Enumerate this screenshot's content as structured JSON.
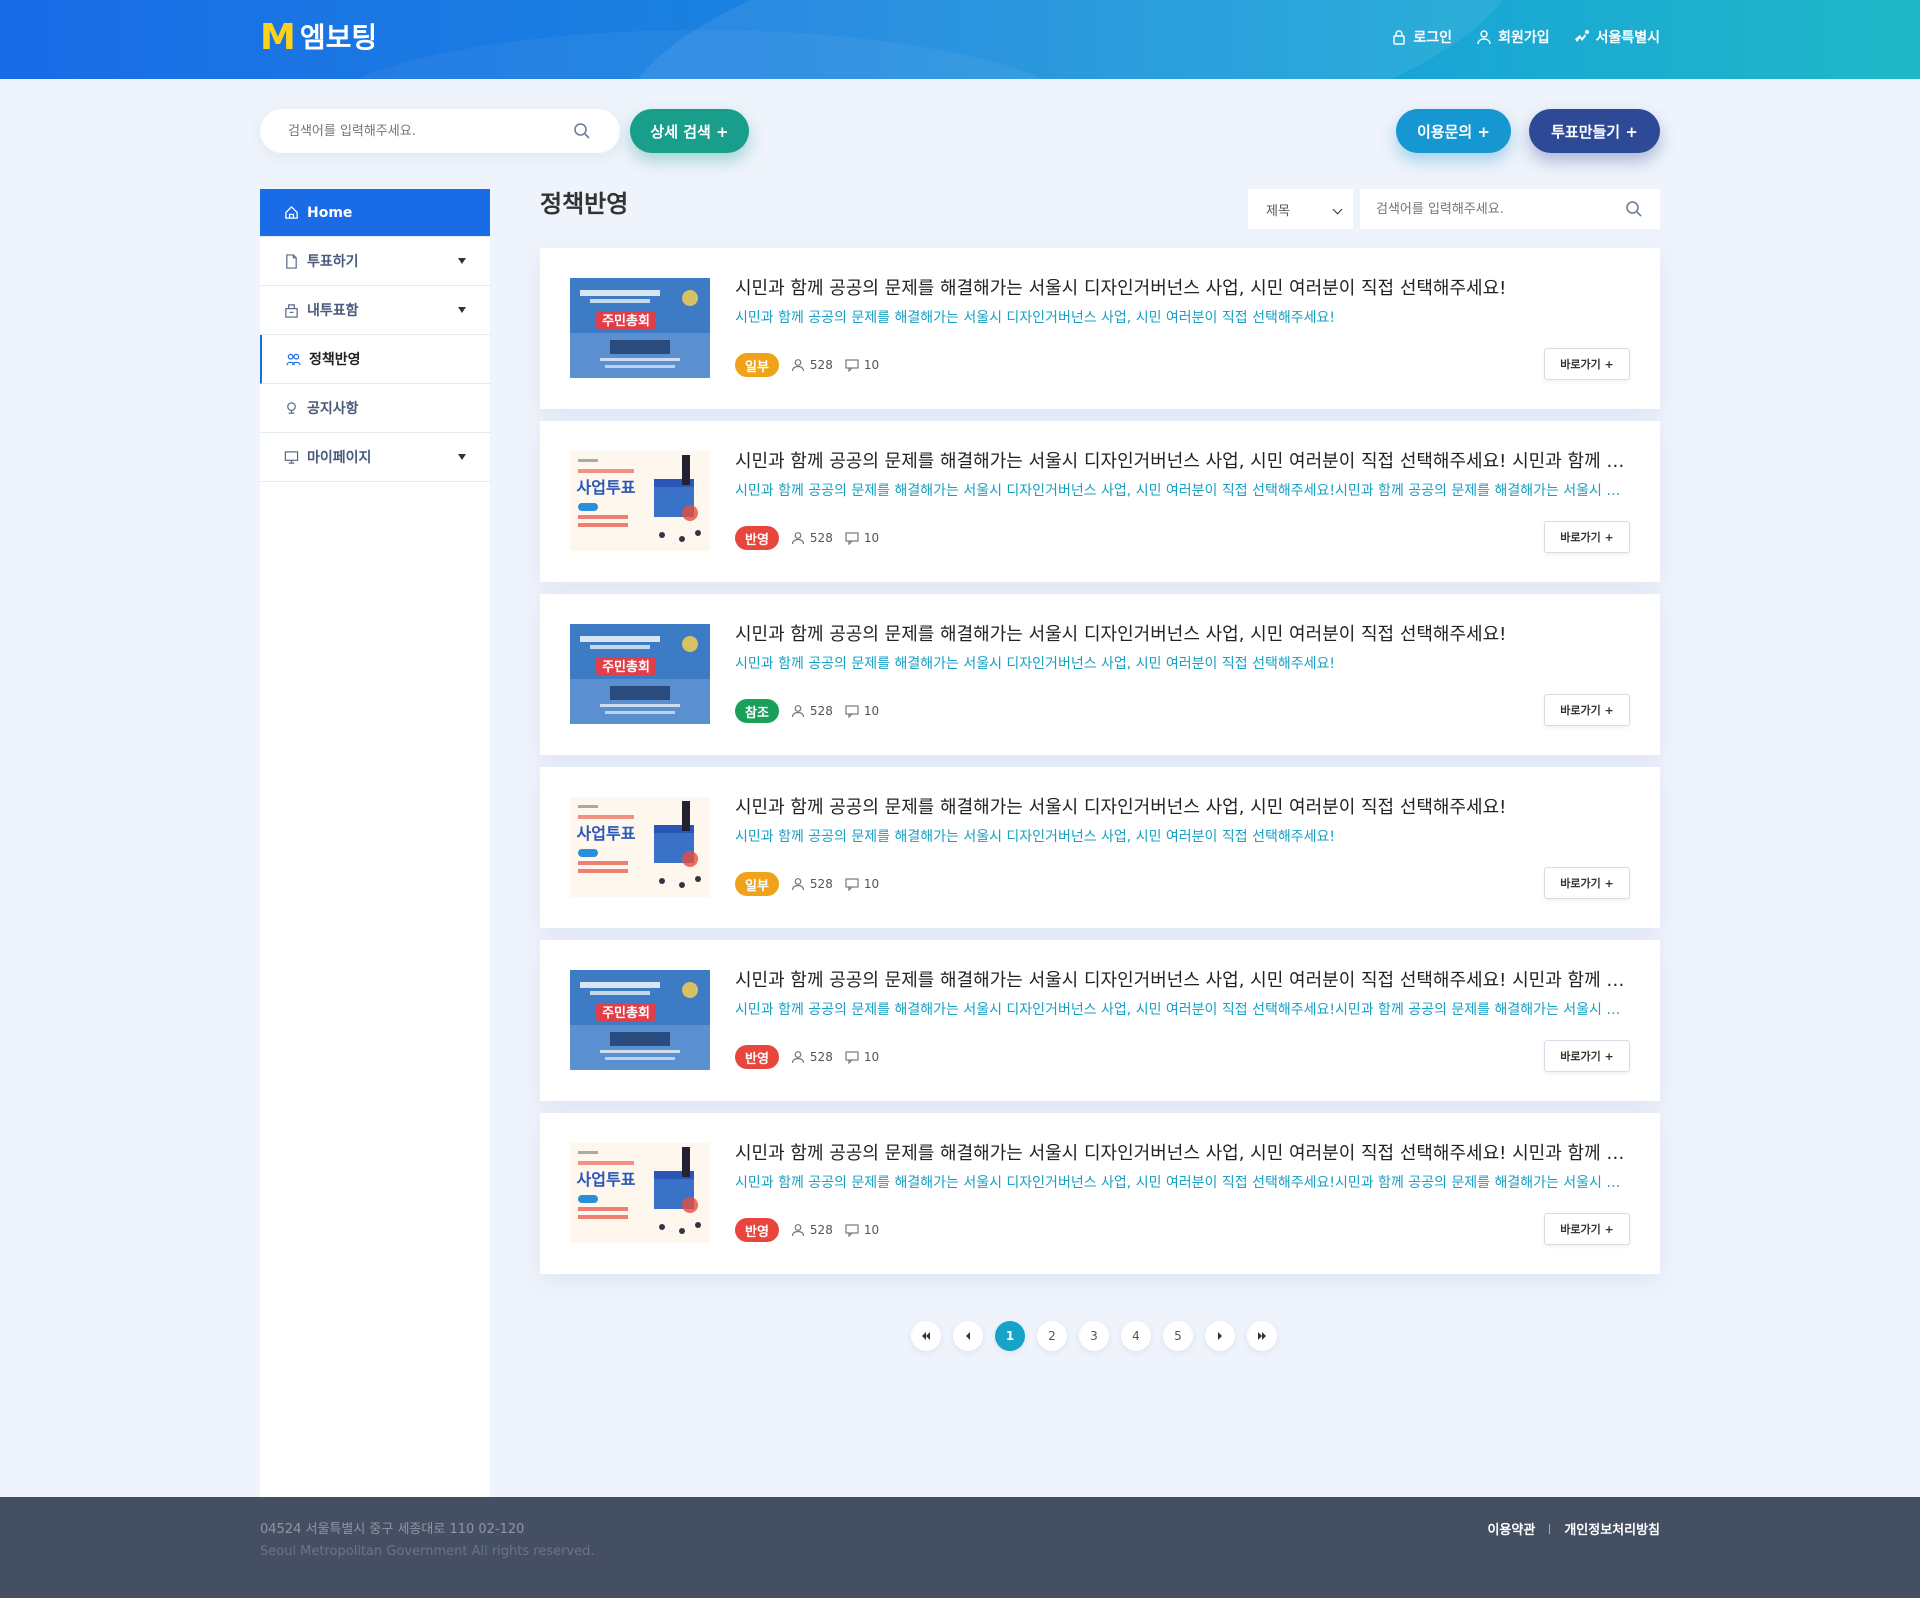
{
  "header": {
    "logo_mark": "M",
    "logo_text": "엠보팅",
    "nav": [
      {
        "label": "로그인",
        "icon": "lock-icon"
      },
      {
        "label": "회원가입",
        "icon": "user-icon"
      },
      {
        "label": "서울특별시",
        "icon": "seoul-logo-icon"
      }
    ]
  },
  "topbar": {
    "search_placeholder": "검색어를 입력해주세요.",
    "detail_search": "상세 검색 +",
    "inquiry": "이용문의 +",
    "make_vote": "투표만들기 +"
  },
  "sidebar": {
    "items": [
      {
        "label": "Home",
        "icon": "home-icon"
      },
      {
        "label": "투표하기",
        "icon": "document-icon"
      },
      {
        "label": "내투표함",
        "icon": "ballot-box-icon"
      },
      {
        "label": "정책반영",
        "icon": "people-icon"
      },
      {
        "label": "공지사항",
        "icon": "pin-icon"
      },
      {
        "label": "마이페이지",
        "icon": "monitor-icon"
      }
    ]
  },
  "main": {
    "page_title": "정책반영",
    "filter_select": "제목",
    "filter_placeholder": "검색어를 입력해주세요.",
    "go_label": "바로가기 +",
    "cards": [
      {
        "thumb": "주민총회",
        "title": "시민과 함께 공공의 문제를 해결해가는 서울시 디자인거버넌스 사업, 시민 여러분이 직접 선택해주세요!",
        "sub": "시민과 함께 공공의 문제를 해결해가는 서울시 디자인거버넌스 사업, 시민 여러분이 직접 선택해주세요!",
        "badge": "일부",
        "badge_color": "#f0a21a",
        "views": "528",
        "comments": "10"
      },
      {
        "thumb": "사업투표",
        "title": "시민과 함께 공공의 문제를 해결해가는 서울시 디자인거버넌스 사업, 시민 여러분이 직접 선택해주세요! 시민과 함께 공공의 문제를 해결해가는 서울시 디자인거버넌스 사업",
        "sub": "시민과 함께 공공의 문제를 해결해가는 서울시 디자인거버넌스 사업, 시민 여러분이 직접 선택해주세요!시민과 함께 공공의 문제를 해결해가는 서울시 디자인거버넌스 사업",
        "badge": "반영",
        "badge_color": "#e8453c",
        "views": "528",
        "comments": "10"
      },
      {
        "thumb": "주민총회",
        "title": "시민과 함께 공공의 문제를 해결해가는 서울시 디자인거버넌스 사업, 시민 여러분이 직접 선택해주세요!",
        "sub": "시민과 함께 공공의 문제를 해결해가는 서울시 디자인거버넌스 사업, 시민 여러분이 직접 선택해주세요!",
        "badge": "참조",
        "badge_color": "#1aa05a",
        "views": "528",
        "comments": "10"
      },
      {
        "thumb": "사업투표",
        "title": "시민과 함께 공공의 문제를 해결해가는 서울시 디자인거버넌스 사업, 시민 여러분이 직접 선택해주세요!",
        "sub": "시민과 함께 공공의 문제를 해결해가는 서울시 디자인거버넌스 사업, 시민 여러분이 직접 선택해주세요!",
        "badge": "일부",
        "badge_color": "#f0a21a",
        "views": "528",
        "comments": "10"
      },
      {
        "thumb": "주민총회",
        "title": "시민과 함께 공공의 문제를 해결해가는 서울시 디자인거버넌스 사업, 시민 여러분이 직접 선택해주세요! 시민과 함께 공공의 문제를 해결해가는 서울시 디자인거버넌스 사업",
        "sub": "시민과 함께 공공의 문제를 해결해가는 서울시 디자인거버넌스 사업, 시민 여러분이 직접 선택해주세요!시민과 함께 공공의 문제를 해결해가는 서울시 디자인거버넌스 사업",
        "badge": "반영",
        "badge_color": "#e8453c",
        "views": "528",
        "comments": "10"
      },
      {
        "thumb": "사업투표",
        "title": "시민과 함께 공공의 문제를 해결해가는 서울시 디자인거버넌스 사업, 시민 여러분이 직접 선택해주세요! 시민과 함께 공공의 문제를 해결해가는 서울시 디자인거버넌스 사업",
        "sub": "시민과 함께 공공의 문제를 해결해가는 서울시 디자인거버넌스 사업, 시민 여러분이 직접 선택해주세요!시민과 함께 공공의 문제를 해결해가는 서울시 디자인거버넌스 사업",
        "badge": "반영",
        "badge_color": "#e8453c",
        "views": "528",
        "comments": "10"
      }
    ]
  },
  "pagination": {
    "pages": [
      "1",
      "2",
      "3",
      "4",
      "5"
    ],
    "current": "1"
  },
  "footer": {
    "address": "04524 서울특별시 중구 세종대로 110    02-120",
    "copyright": "Seoul Metropolitan Government All rights reserved.",
    "terms": "이용약관",
    "privacy": "개인정보처리방침"
  },
  "colors": {
    "primary": "#1a6be6",
    "accent_teal": "#1a9e8c",
    "accent_blue": "#1697d2",
    "accent_navy": "#2e4a96",
    "sub_text": "#17a0c4"
  }
}
